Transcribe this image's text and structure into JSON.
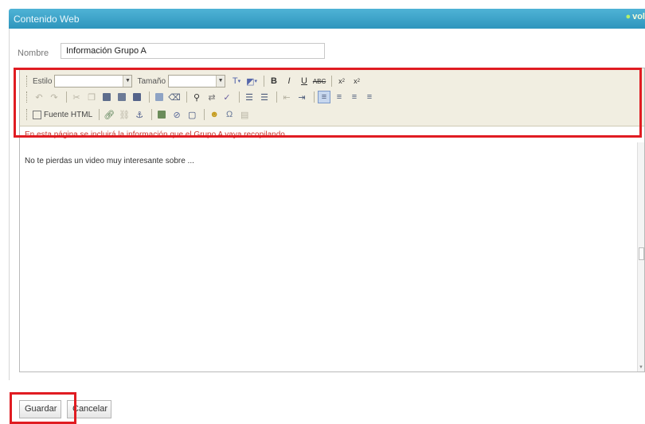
{
  "panel": {
    "title": "Contenido Web",
    "back_link": "vol"
  },
  "form": {
    "name_label": "Nombre",
    "name_value": "Información Grupo A"
  },
  "toolbar": {
    "style_label": "Estilo",
    "size_label": "Tamaño",
    "source_label": "Fuente HTML",
    "row1_icons": [
      "text-color-icon",
      "background-color-icon",
      "bold-icon",
      "italic-icon",
      "underline-icon",
      "strikethrough-icon",
      "subscript-icon",
      "superscript-icon"
    ],
    "row2_icons": [
      "undo-icon",
      "redo-icon",
      "cut-icon",
      "copy-icon",
      "paste-icon",
      "paste-text-icon",
      "paste-word-icon",
      "select-all-icon",
      "remove-format-icon",
      "find-icon",
      "replace-icon",
      "spellcheck-icon",
      "numbered-list-icon",
      "bulleted-list-icon",
      "outdent-icon",
      "indent-icon",
      "align-left-icon",
      "align-center-icon",
      "align-right-icon",
      "justify-icon"
    ],
    "row3_icons": [
      "source-icon",
      "link-icon",
      "unlink-icon",
      "anchor-icon",
      "image-icon",
      "flash-icon",
      "table-icon",
      "smiley-icon",
      "special-char-icon",
      "page-break-icon"
    ]
  },
  "editor": {
    "line1": "En esta página se incluirá la información que el Grupo A vaya recopilando",
    "line2": "No te pierdas un video muy interesante sobre ..."
  },
  "actions": {
    "save_label": "Guardar",
    "cancel_label": "Cancelar"
  },
  "colors": {
    "header_blue": "#2e95bd",
    "highlight_red": "#e01c22",
    "content_red": "#c8362e",
    "toolbar_bg": "#f1eee1"
  }
}
